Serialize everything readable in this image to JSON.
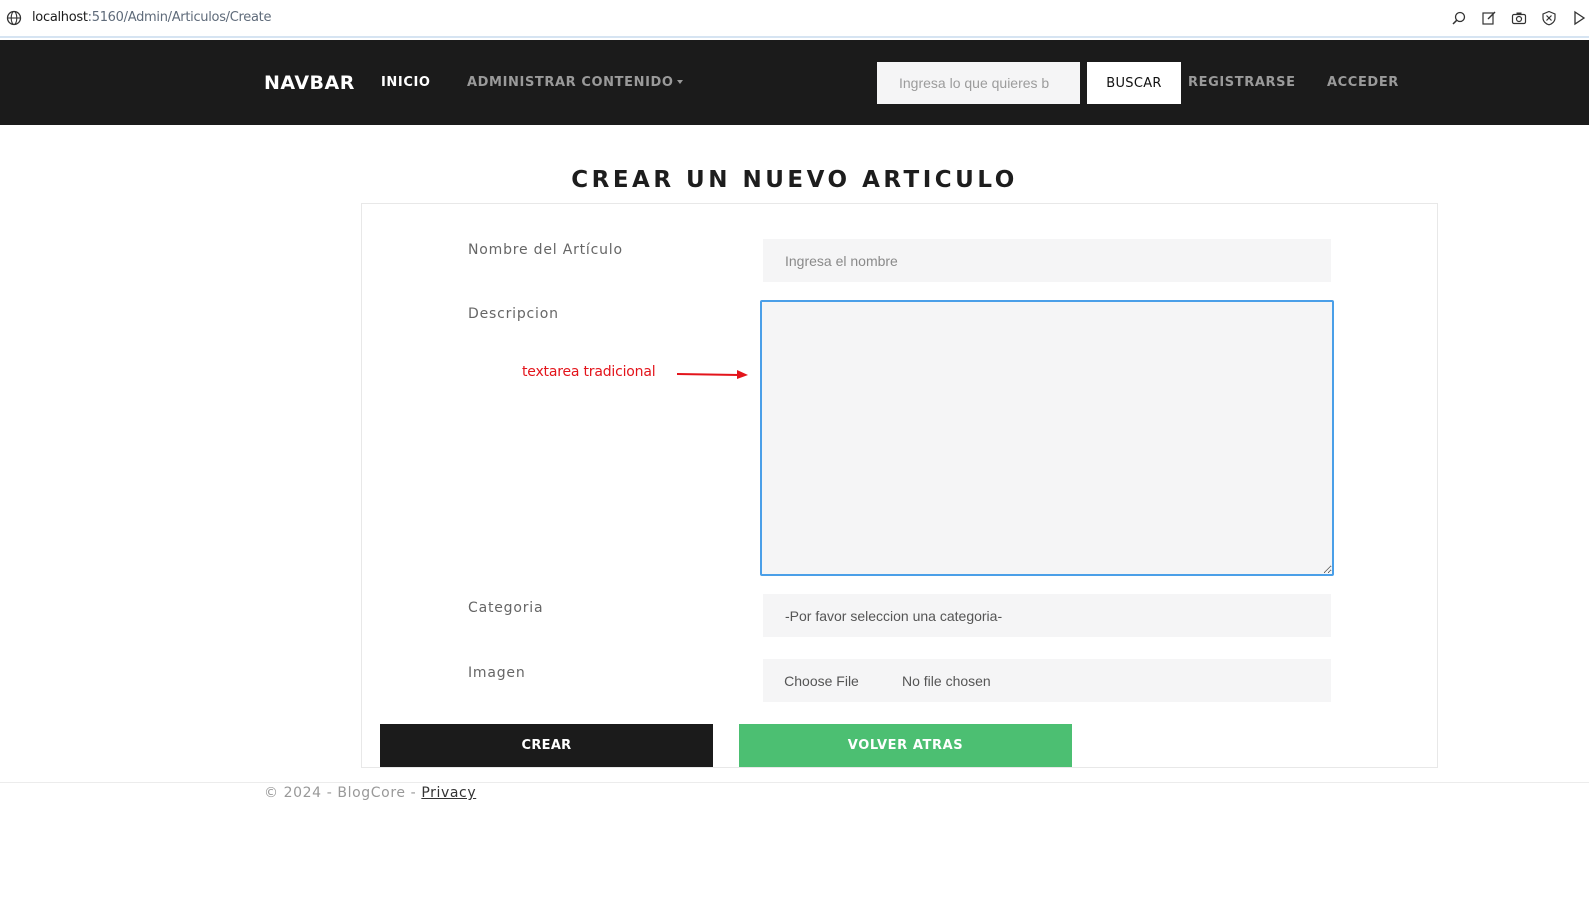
{
  "browser": {
    "url_host": "localhost",
    "url_rest": ":5160/Admin/Articulos/Create"
  },
  "navbar": {
    "brand": "NAVBAR",
    "inicio": "INICIO",
    "admin": "ADMINISTRAR CONTENIDO",
    "search_placeholder": "Ingresa lo que quieres b",
    "search_button": "BUSCAR",
    "register": "REGISTRARSE",
    "login": "ACCEDER"
  },
  "page": {
    "title": "CREAR UN NUEVO ARTICULO"
  },
  "form": {
    "name_label": "Nombre del Artículo",
    "name_placeholder": "Ingresa el nombre",
    "desc_label": "Descripcion",
    "category_label": "Categoria",
    "category_selected": "-Por favor seleccion una categoria-",
    "image_label": "Imagen",
    "file_button": "Choose File",
    "file_status": "No file chosen",
    "annotation": "textarea tradicional",
    "create_button": "CREAR",
    "back_button": "VOLVER ATRAS"
  },
  "footer": {
    "copyright": "© 2024 - BlogCore - ",
    "privacy": "Privacy"
  },
  "colors": {
    "navbar_bg": "#1b1b1b",
    "accent_green": "#4cbf72",
    "focus_blue": "#4a9fe8",
    "annotation_red": "#e3141b"
  }
}
